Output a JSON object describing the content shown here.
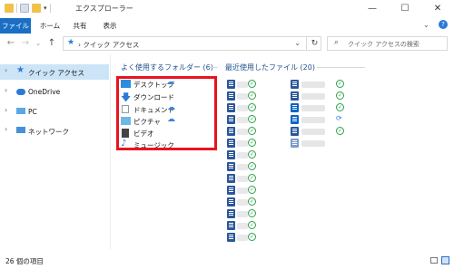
{
  "window": {
    "title": "エクスプローラー"
  },
  "ribbon": {
    "tabs": [
      "ファイル",
      "ホーム",
      "共有",
      "表示"
    ]
  },
  "address": {
    "breadcrumb": "クイック アクセス",
    "search_placeholder": "クイック アクセスの検索"
  },
  "nav": {
    "items": [
      {
        "label": "クイック アクセス",
        "icon": "star-icon"
      },
      {
        "label": "OneDrive",
        "icon": "cloud-icon"
      },
      {
        "label": "PC",
        "icon": "pc-icon"
      },
      {
        "label": "ネットワーク",
        "icon": "network-icon"
      }
    ]
  },
  "sections": {
    "frequent_title": "よく使用するフォルダー (6)",
    "recent_title": "最近使用したファイル (20)"
  },
  "folders": [
    {
      "label": "デスクトップ",
      "icon": "desktop-icon",
      "onedrive": true
    },
    {
      "label": "ダウンロード",
      "icon": "download-icon",
      "onedrive": false
    },
    {
      "label": "ドキュメント",
      "icon": "document-icon",
      "onedrive": true
    },
    {
      "label": "ピクチャ",
      "icon": "pictures-icon",
      "onedrive": true
    },
    {
      "label": "ビデオ",
      "icon": "video-icon",
      "onedrive": false
    },
    {
      "label": "ミュージック",
      "icon": "music-icon",
      "onedrive": false
    }
  ],
  "status": {
    "text": "26 個の項目"
  },
  "colors": {
    "accent": "#1a6fc4",
    "highlight_box": "#e8141d",
    "synced": "#2fa14a"
  }
}
